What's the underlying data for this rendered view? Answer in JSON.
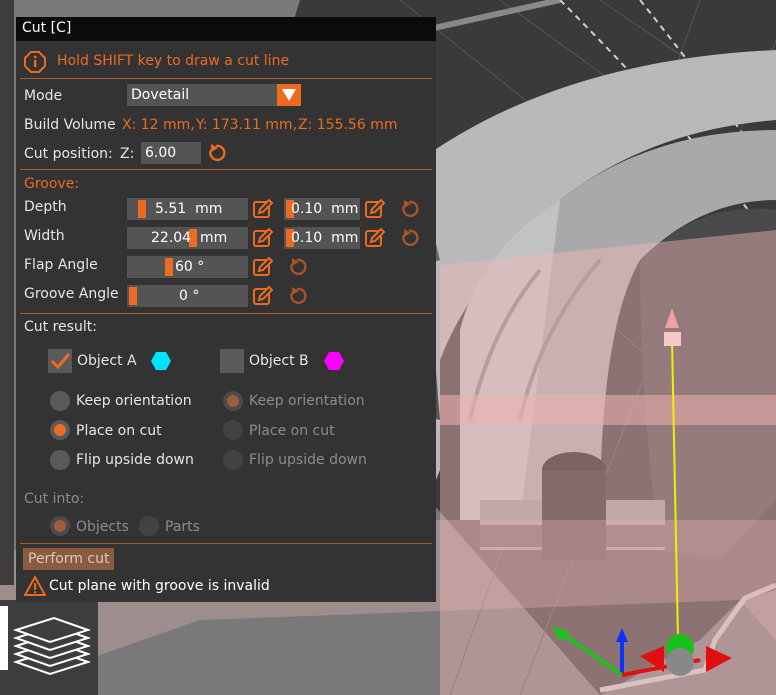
{
  "window": {
    "title": "Cut [C]"
  },
  "hint": {
    "text": "Hold SHIFT key to draw a cut line"
  },
  "mode": {
    "label": "Mode",
    "value": "Dovetail"
  },
  "build_volume": {
    "label": "Build Volume",
    "x": "X: 12 mm,",
    "y": "Y: 173.11 mm,",
    "z": "Z: 155.56 mm"
  },
  "cut_position": {
    "label": "Cut position:",
    "axis": "Z:",
    "value": "6.00"
  },
  "groove": {
    "heading": "Groove:",
    "depth": {
      "label": "Depth",
      "value": "5.51",
      "unit": "mm",
      "tolerance": "0.10",
      "tolerance_unit": "mm",
      "slider": 0.08
    },
    "width": {
      "label": "Width",
      "value": "22.04",
      "unit": "mm",
      "tolerance": "0.10",
      "tolerance_unit": "mm",
      "slider": 0.55
    },
    "flap_angle": {
      "label": "Flap Angle",
      "value": "60 °",
      "slider": 0.33
    },
    "groove_angle": {
      "label": "Groove Angle",
      "value": "0 °",
      "slider": 0.0
    }
  },
  "cut_result": {
    "heading": "Cut result:",
    "object_a": {
      "label": "Object A",
      "checked": true,
      "color": "#00e5ff"
    },
    "object_b": {
      "label": "Object B",
      "checked": false,
      "color": "#ff00ff"
    },
    "options_a": {
      "keep": "Keep orientation",
      "place": "Place on cut",
      "flip": "Flip upside down",
      "selected": "Place on cut"
    },
    "options_b": {
      "keep": "Keep orientation",
      "place": "Place on cut",
      "flip": "Flip upside down",
      "selected": "Keep orientation"
    }
  },
  "cut_into": {
    "label": "Cut into:",
    "objects": "Objects",
    "parts": "Parts",
    "selected": "Objects"
  },
  "perform_cut": {
    "label": "Perform cut"
  },
  "warning": {
    "text": "Cut plane with groove is invalid"
  },
  "colors": {
    "accent": "#ed6b21",
    "panel": "#333333",
    "field": "#545454"
  }
}
